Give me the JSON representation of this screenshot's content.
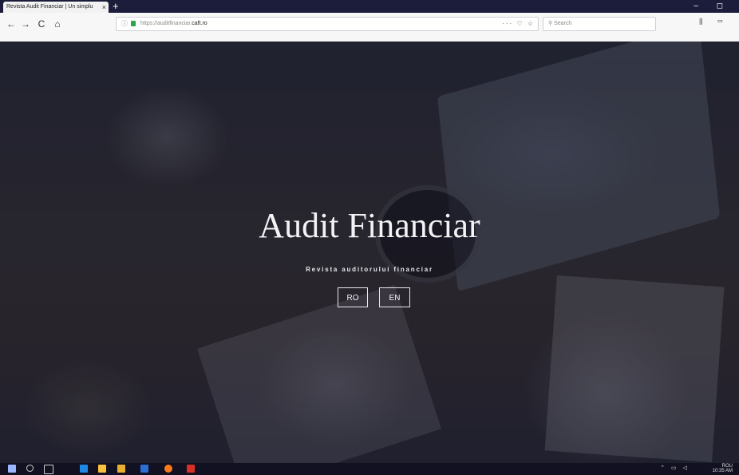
{
  "browser": {
    "tab_title": "Revista Audit Financiar | Un simplu",
    "tab_close": "×",
    "new_tab": "+",
    "window_controls": "– ◻",
    "nav": {
      "back": "←",
      "forward": "→",
      "reload": "C",
      "home": "⌂"
    },
    "url_prefix": "https://auditfinanciar.",
    "url_domain": "caft.ro",
    "url_actions": "··· ♡ ☆",
    "search_placeholder": "Search",
    "toolbar_right": "⫼ ▭"
  },
  "hero": {
    "title": "Audit Financiar",
    "subtitle": "Revista auditorului financiar",
    "lang_ro": "RO",
    "lang_en": "EN"
  },
  "taskbar": {
    "tray_icons": "⌃ ▭ ◁",
    "language": "ROU",
    "time": "10:35 AM"
  },
  "colors": {
    "tab_bar": "#1b1d3a",
    "overlay": "#12142a",
    "title_text": "#f3f3f5",
    "taskbar": "#111122"
  }
}
